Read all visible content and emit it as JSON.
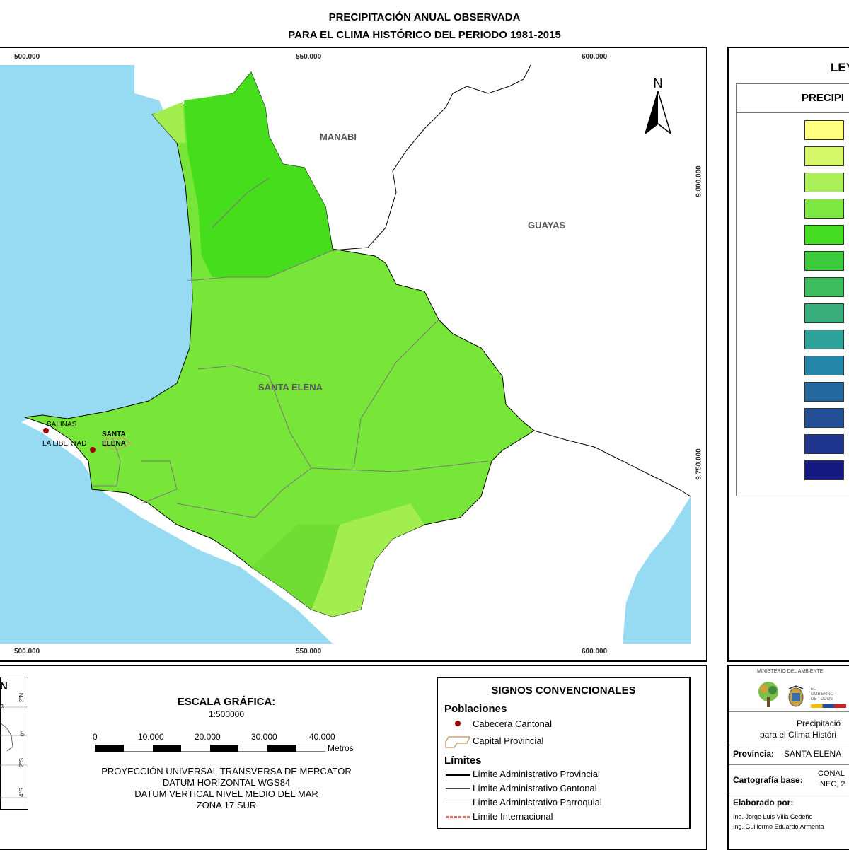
{
  "title": {
    "line1": "PRECIPITACIÓN ANUAL OBSERVADA",
    "line2": "PARA EL CLIMA HISTÓRICO DEL PERIODO 1981-2015"
  },
  "map": {
    "x_ticks_top": [
      "500.000",
      "550.000",
      "600.000"
    ],
    "x_ticks_bottom": [
      "500.000",
      "550.000",
      "600.000"
    ],
    "y_ticks": [
      "9.800.000",
      "9.750.000"
    ],
    "north": "N",
    "regions": {
      "manabi": "MANABI",
      "guayas": "GUAYAS",
      "santa_elena": "SANTA ELENA"
    },
    "towns": {
      "salinas": "SALINAS",
      "la_libertad": "LA LIBERTAD",
      "santa_elena_1": "SANTA",
      "santa_elena_2": "ELENA"
    },
    "colors": {
      "sea": "#97dbf2",
      "land": "#ffffff",
      "zone_light": "#a3ee4f",
      "zone_mid": "#78e638",
      "zone_dark": "#45dd1c"
    }
  },
  "legend": {
    "header": "LEY",
    "subheader": "PRECIPI",
    "swatches": [
      "#ffff80",
      "#d6f76a",
      "#aaef57",
      "#7ee843",
      "#46de22",
      "#3bcb3d",
      "#3dbd5d",
      "#38ae7c",
      "#2da39a",
      "#2385a8",
      "#2468a0",
      "#234f96",
      "#1f358e",
      "#141a82"
    ]
  },
  "inset": {
    "title": "N",
    "ticks": [
      "2°N",
      "0°",
      "2°S",
      "4°S"
    ],
    "label": "a"
  },
  "scale": {
    "title": "ESCALA GRÁFICA:",
    "ratio": "1:500000",
    "ticks": [
      "0",
      "10.000",
      "20.000",
      "30.000",
      "40.000"
    ],
    "unit": "Metros",
    "projection": [
      "PROYECCIÓN UNIVERSAL TRANSVERSA DE MERCATOR",
      "DATUM HORIZONTAL WGS84",
      "DATUM VERTICAL NIVEL MEDIO DEL MAR",
      "ZONA 17 SUR"
    ]
  },
  "signs": {
    "title": "SIGNOS CONVENCIONALES",
    "populations_header": "Poblaciones",
    "cabecera": "Cabecera Cantonal",
    "capital": "Capital Provincial",
    "limits_header": "Límites",
    "provincial": "Límite Administrativo Provincial",
    "cantonal": "Límite Administrativo Cantonal",
    "parroquial": "Límite Administrativo Parroquial",
    "internacional": "Límite Internacional",
    "colors": {
      "cabecera": "#a00000",
      "capital": "#c8a06e",
      "internacional": "#d9665c"
    }
  },
  "info": {
    "ministry": "MINISTERIO DEL AMBIENTE",
    "gob_small": "EL GOBIERNO DE TODOS",
    "desc1": "Precipitació",
    "desc2": "para el Clima Históri",
    "provincia_label": "Provincia:",
    "provincia_value": "SANTA ELENA",
    "cartografia_label": "Cartografía base:",
    "cartografia_value1": "CONAL",
    "cartografia_value2": "INEC, 2",
    "elaborado_label": "Elaborado por:",
    "author1": "Ing. Jorge Luis Villa Cedeño",
    "author2": "Ing. Guillermo Eduardo Armenta"
  }
}
